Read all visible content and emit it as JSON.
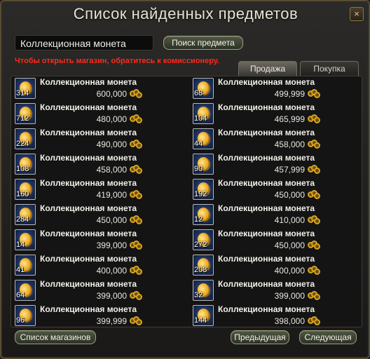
{
  "window": {
    "title": "Список найденных предметов",
    "close_glyph": "×"
  },
  "search": {
    "value": "Коллекционная монета",
    "button_label": "Поиск предмета"
  },
  "notice": "Чтобы открыть магазин, обратитесь к комиссионеру.",
  "tabs": [
    {
      "label": "Продажа",
      "active": true
    },
    {
      "label": "Покупка",
      "active": false
    }
  ],
  "items_left": [
    {
      "qty": "314",
      "name": "Коллекционная монета",
      "price": "600,000"
    },
    {
      "qty": "712",
      "name": "Коллекционная монета",
      "price": "480,000"
    },
    {
      "qty": "224",
      "name": "Коллекционная монета",
      "price": "490,000"
    },
    {
      "qty": "108",
      "name": "Коллекционная монета",
      "price": "458,000"
    },
    {
      "qty": "160",
      "name": "Коллекционная монета",
      "price": "419,000"
    },
    {
      "qty": "284",
      "name": "Коллекционная монета",
      "price": "450,000"
    },
    {
      "qty": "14",
      "name": "Коллекционная монета",
      "price": "399,000"
    },
    {
      "qty": "41",
      "name": "Коллекционная монета",
      "price": "400,000"
    },
    {
      "qty": "64",
      "name": "Коллекционная монета",
      "price": "399,000"
    },
    {
      "qty": "96",
      "name": "Коллекционная монета",
      "price": "399,999"
    }
  ],
  "items_right": [
    {
      "qty": "68",
      "name": "Коллекционная монета",
      "price": "499,999"
    },
    {
      "qty": "104",
      "name": "Коллекционная монета",
      "price": "465,999"
    },
    {
      "qty": "44",
      "name": "Коллекционная монета",
      "price": "458,000"
    },
    {
      "qty": "90",
      "name": "Коллекционная монета",
      "price": "457,999"
    },
    {
      "qty": "192",
      "name": "Коллекционная монета",
      "price": "450,000"
    },
    {
      "qty": "12",
      "name": "Коллекционная монета",
      "price": "410,000"
    },
    {
      "qty": "272",
      "name": "Коллекционная монета",
      "price": "450,000"
    },
    {
      "qty": "208",
      "name": "Коллекционная монета",
      "price": "400,000"
    },
    {
      "qty": "32",
      "name": "Коллекционная монета",
      "price": "399,000"
    },
    {
      "qty": "144",
      "name": "Коллекционная монета",
      "price": "398,000"
    }
  ],
  "item_icon": "collectible-coin-icon",
  "price_icon": "adena-coins-icon",
  "footer": {
    "shops_label": "Список магазинов",
    "prev_label": "Предыдущая",
    "next_label": "Следующая"
  },
  "colors": {
    "notice": "#ff2a1a",
    "accent_border": "#9da17a"
  }
}
